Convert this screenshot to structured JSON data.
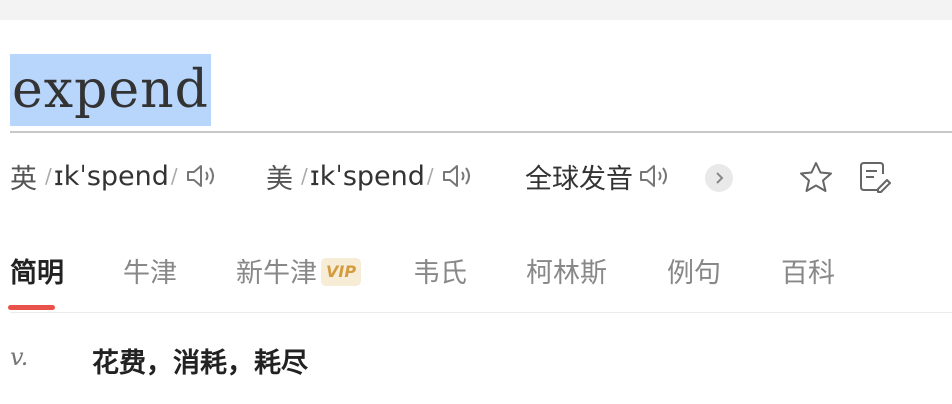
{
  "word": "expend",
  "pronunciations": [
    {
      "label": "英",
      "ipa": "ɪkˈspend"
    },
    {
      "label": "美",
      "ipa": "ɪkˈspend"
    }
  ],
  "global_pronunciation_label": "全球发音",
  "icons": [
    "speaker-icon",
    "chevron-right-icon",
    "star-icon",
    "note-edit-icon"
  ],
  "tabs": [
    {
      "label": "简明",
      "active": true
    },
    {
      "label": "牛津"
    },
    {
      "label": "新牛津",
      "badge": "VIP"
    },
    {
      "label": "韦氏"
    },
    {
      "label": "柯林斯"
    },
    {
      "label": "例句"
    },
    {
      "label": "百科"
    }
  ],
  "definition": {
    "pos": "v.",
    "meaning": "花费，消耗，耗尽"
  },
  "colors": {
    "selection": "#b8d5fc",
    "active_tab_indicator": "#e8524a",
    "vip_text": "#d39c3f",
    "vip_bg": "#f7ecd6"
  }
}
